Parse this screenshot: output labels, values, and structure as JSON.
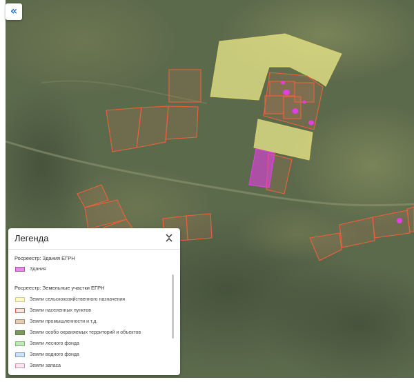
{
  "sidebar_toggle": {
    "icon": "double-chevron-left-icon",
    "glyph": "«"
  },
  "legend": {
    "title": "Легенда",
    "toggle_icon": "chevron-collapse-icon",
    "sections": [
      {
        "title": "Росреестр: Здания ЕГРН",
        "items": [
          {
            "label": "Здания",
            "fill": "#e58ce5",
            "border": "#c040c0"
          }
        ]
      },
      {
        "title": "Росреестр: Земельные участки ЕГРН",
        "items": [
          {
            "label": "Земли сельскохозяйственного назначения",
            "fill": "#fdf9c4",
            "border": "#d6cd7a"
          },
          {
            "label": "Земли населенных пунктов",
            "fill": "#fde4df",
            "border": "#e0604a"
          },
          {
            "label": "Земли промышленности и т.д.",
            "fill": "#e3cdb8",
            "border": "#b08a66"
          },
          {
            "label": "Земли особо охраняемых территорий и объектов",
            "fill": "#7a9a5e",
            "border": "#5c7a44"
          },
          {
            "label": "Земли лесного фонда",
            "fill": "#bfe9b8",
            "border": "#6cc060"
          },
          {
            "label": "Земли водного фонда",
            "fill": "#cfe0ff",
            "border": "#7a9ee0"
          },
          {
            "label": "Земли запаса",
            "fill": "#fbe2f0",
            "border": "#e08ab8"
          }
        ]
      }
    ]
  },
  "colors": {
    "parcel_settlement": "#f0603a",
    "parcel_agri_fill": "#f2f08e",
    "building": "#e040e0"
  }
}
